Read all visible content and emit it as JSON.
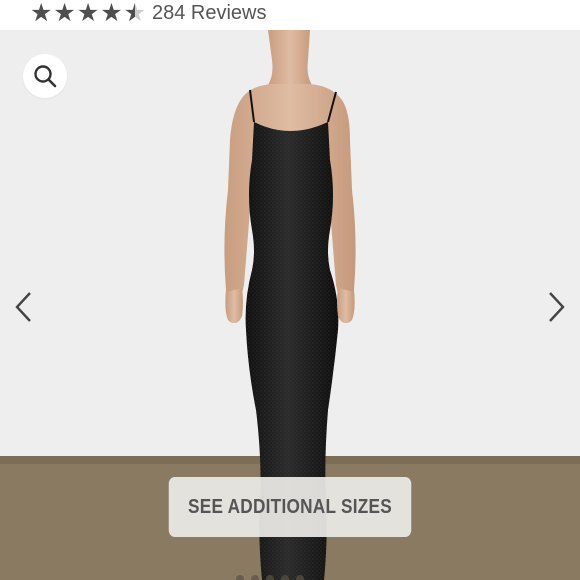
{
  "rating": {
    "stars_filled": 4.5,
    "stars_total": 5,
    "review_count_label": "284 Reviews"
  },
  "gallery": {
    "zoom_icon": "search-icon",
    "prev_icon": "chevron-left-icon",
    "next_icon": "chevron-right-icon",
    "cta_label": "SEE ADDITIONAL SIZES",
    "image_description_icon": "product-photo",
    "slide_count": 5
  },
  "colors": {
    "background": "#eeeeee",
    "floor": "#8a7a62",
    "dress": "#1c1c1c",
    "skin": "#d9b59b",
    "star": "#4f4f4f",
    "text": "#555555"
  }
}
